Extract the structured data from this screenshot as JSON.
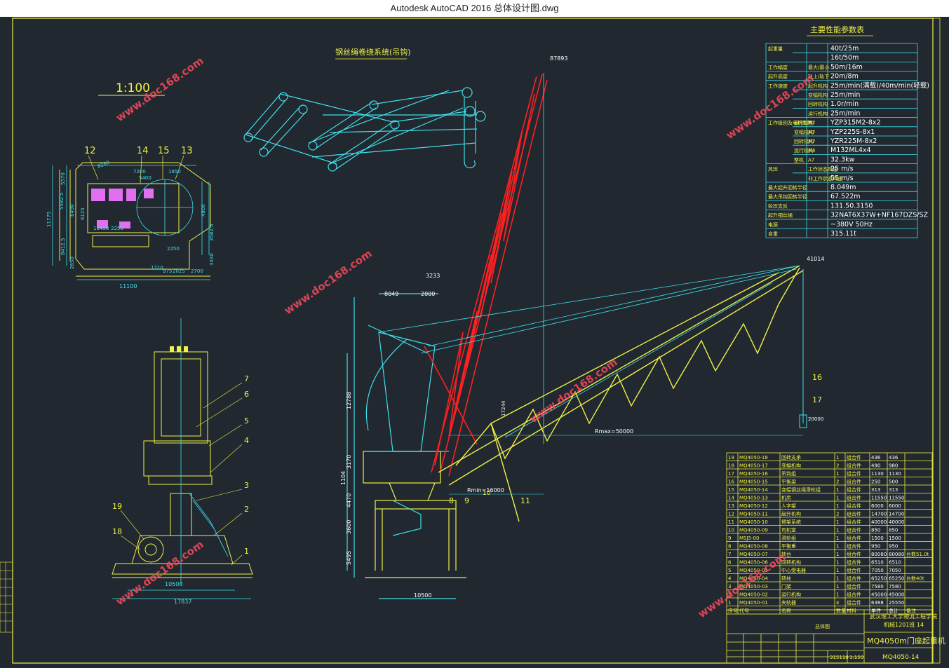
{
  "window": {
    "title": "Autodesk AutoCAD 2016     总体设计图.dwg"
  },
  "colors": {
    "background": "#212830",
    "frame": "#f0f046",
    "dim": "#3fe0ea",
    "jib_red": "#ff2020",
    "jib_yellow": "#f0f046",
    "watermark": "#ff4b5c"
  },
  "drawing": {
    "scale_label": "1:100",
    "rope_system_title": "钢丝绳卷绕系统(吊钩)",
    "watermark": "www.doc168.com",
    "top_marker": "87893",
    "tip_marker": "41014",
    "rmax_label": "Rmax=50000",
    "rmin_label": "Rmin=16000",
    "plan_callouts": [
      "12",
      "14",
      "15",
      "13"
    ],
    "plan_dims": [
      "8280",
      "7200",
      "5400",
      "1850",
      "11100",
      "11775",
      "5570",
      "6490",
      "6125",
      "8412.5",
      "2650",
      "5582.5",
      "4800",
      "3582.5",
      "3030",
      "11458",
      "2250",
      "2250",
      "1710",
      "2025",
      "2700",
      "975"
    ],
    "side_callouts": [
      "7",
      "6",
      "5",
      "4",
      "3",
      "2",
      "1",
      "19",
      "18"
    ],
    "side_dims": [
      "10500",
      "17837"
    ],
    "main_callouts": [
      "8",
      "9",
      "10",
      "11",
      "16",
      "17"
    ],
    "main_dims": [
      "8049",
      "3233",
      "2000",
      "12788",
      "3170",
      "1104",
      "4470",
      "3600",
      "5495",
      "10500",
      "20000",
      "17244"
    ]
  },
  "perf_table": {
    "title": "主要性能参数表",
    "rows": [
      [
        "起重量",
        "",
        "",
        "40t/25m"
      ],
      [
        "",
        "",
        "",
        "16t/50m"
      ],
      [
        "工作幅度",
        "",
        "最大/最小",
        "50m/16m"
      ],
      [
        "起升高度",
        "",
        "轨上/轨下",
        "20m/8m"
      ],
      [
        "工作速度",
        "",
        "起升机构",
        "25m/min(满载)/40m/min(轻载)"
      ],
      [
        "",
        "",
        "变幅机构",
        "25m/min"
      ],
      [
        "",
        "",
        "回转机构",
        "1.0r/min"
      ],
      [
        "",
        "",
        "运行机构",
        "25m/min"
      ],
      [
        "工作级别及电机型号",
        "起升机构",
        "M7",
        "YZP315M2-8x2"
      ],
      [
        "",
        "变幅机构",
        "M7",
        "YZP225S-8x1"
      ],
      [
        "",
        "回转机构",
        "M7",
        "YZR225M-8x2"
      ],
      [
        "",
        "运行机构",
        "M4",
        "M132ML4x4"
      ],
      [
        "",
        "整机",
        "A7",
        "32.3kw"
      ],
      [
        "风压",
        "",
        "工作状态风速",
        "25 m/s"
      ],
      [
        "",
        "",
        "非工作状态风速",
        "55 m/s"
      ],
      [
        "最大起升回转半径",
        "",
        "",
        "8.049m"
      ],
      [
        "最大吊钩回转半径",
        "",
        "",
        "67.522m"
      ],
      [
        "轮压支反",
        "",
        "",
        "131.50.3150"
      ],
      [
        "起升钢丝绳",
        "",
        "",
        "32NAT6X37W+NF167DZS/SZ"
      ],
      [
        "电源",
        "",
        "",
        "~380V 50Hz"
      ],
      [
        "自重",
        "",
        "",
        "315.11t"
      ]
    ]
  },
  "bom_table": {
    "rows": [
      [
        "19",
        "MQ4050-18",
        "回转支承",
        "1",
        "组合件",
        "436",
        "436",
        ""
      ],
      [
        "18",
        "MQ4050-17",
        "变幅机构",
        "2",
        "组合件",
        "490",
        "980",
        ""
      ],
      [
        "17",
        "MQ4050-16",
        "吊钩组",
        "1",
        "组合件",
        "1130",
        "1130",
        ""
      ],
      [
        "16",
        "MQ4050-15",
        "平衡梁",
        "2",
        "组合件",
        "250",
        "500",
        ""
      ],
      [
        "15",
        "MQ4050-14",
        "变幅钢丝绳滑轮组",
        "1",
        "组合件",
        "313",
        "313",
        ""
      ],
      [
        "14",
        "MQ4050-13",
        "机房",
        "1",
        "组合件",
        "11550",
        "11550",
        ""
      ],
      [
        "13",
        "MQ4050-12",
        "人字架",
        "1",
        "组合件",
        "6000",
        "6000",
        ""
      ],
      [
        "12",
        "MQ4050-11",
        "起升机构",
        "2",
        "组合件",
        "14700",
        "14700",
        ""
      ],
      [
        "11",
        "MQ4050-10",
        "臂架系统",
        "1",
        "组合件",
        "40000",
        "40000",
        ""
      ],
      [
        "10",
        "MQ4050-09",
        "司机室",
        "1",
        "组合件",
        "850",
        "850",
        ""
      ],
      [
        "9",
        "MSJ5-00",
        "滑轮组",
        "1",
        "组合件",
        "1500",
        "1500",
        ""
      ],
      [
        "8",
        "MQ4050-08",
        "平衡重",
        "1",
        "组合件",
        "950",
        "950",
        ""
      ],
      [
        "7",
        "MQ4050-07",
        "转台",
        "1",
        "组合件",
        "80080",
        "80080",
        "台数51.0t"
      ],
      [
        "6",
        "MQ4050-06",
        "回转机构",
        "1",
        "组合件",
        "6510",
        "6510",
        ""
      ],
      [
        "5",
        "MQ4050-05",
        "中心受电器",
        "1",
        "组合件",
        "7050",
        "7050",
        ""
      ],
      [
        "4",
        "MQ4050-04",
        "转柱",
        "1",
        "组合件",
        "65250",
        "65250",
        "台数40t"
      ],
      [
        "3",
        "MQ4050-03",
        "门架",
        "1",
        "组合件",
        "7580",
        "7580",
        ""
      ],
      [
        "2",
        "MQ4050-02",
        "运行机构",
        "1",
        "组合件",
        "45000",
        "45000",
        ""
      ],
      [
        "1",
        "MQ4050-01",
        "夹轨器",
        "4",
        "组合件",
        "6388",
        "25550",
        ""
      ]
    ],
    "header": [
      "序号",
      "代号",
      "名称",
      "数量",
      "材料",
      "单件",
      "总计",
      "备注"
    ]
  },
  "title_block": {
    "school": "武汉理工大学物流工程学院",
    "class": "机械1201班 14",
    "drawing_name": "MQ4050m门座起重机",
    "drawing_no": "MQ4050-14",
    "weight": "315118",
    "scale": "1:150",
    "design": "总体图"
  }
}
